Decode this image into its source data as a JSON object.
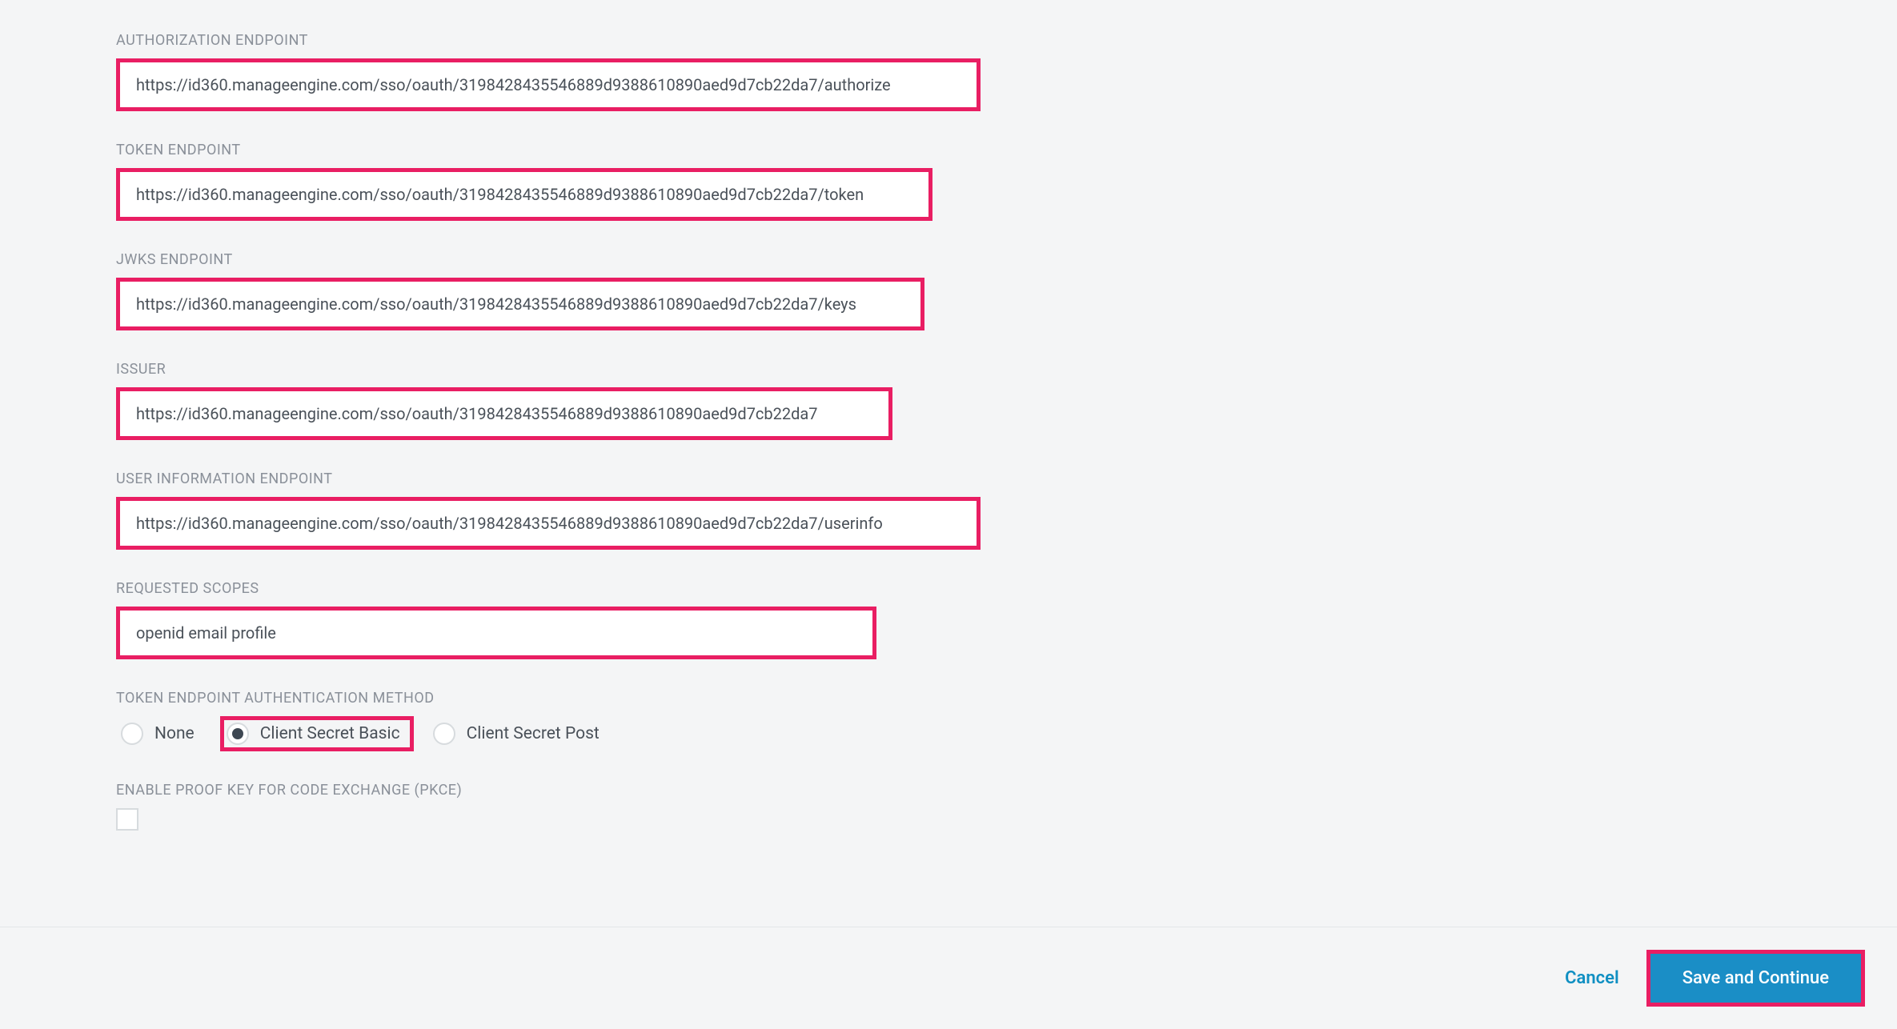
{
  "fields": {
    "authorization": {
      "label": "AUTHORIZATION ENDPOINT",
      "value": "https://id360.manageengine.com/sso/oauth/3198428435546889d9388610890aed9d7cb22da7/authorize"
    },
    "token": {
      "label": "TOKEN ENDPOINT",
      "value": "https://id360.manageengine.com/sso/oauth/3198428435546889d9388610890aed9d7cb22da7/token"
    },
    "jwks": {
      "label": "JWKS ENDPOINT",
      "value": "https://id360.manageengine.com/sso/oauth/3198428435546889d9388610890aed9d7cb22da7/keys"
    },
    "issuer": {
      "label": "ISSUER",
      "value": "https://id360.manageengine.com/sso/oauth/3198428435546889d9388610890aed9d7cb22da7"
    },
    "userinfo": {
      "label": "USER INFORMATION ENDPOINT",
      "value": "https://id360.manageengine.com/sso/oauth/3198428435546889d9388610890aed9d7cb22da7/userinfo"
    },
    "scopes": {
      "label": "REQUESTED SCOPES",
      "value": "openid email profile"
    }
  },
  "auth_method": {
    "label": "TOKEN ENDPOINT AUTHENTICATION METHOD",
    "options": {
      "none": "None",
      "basic": "Client Secret Basic",
      "post": "Client Secret Post"
    },
    "selected": "basic"
  },
  "pkce": {
    "label": "ENABLE PROOF KEY FOR CODE EXCHANGE (PKCE)",
    "checked": false
  },
  "footer": {
    "cancel": "Cancel",
    "save": "Save and Continue"
  }
}
